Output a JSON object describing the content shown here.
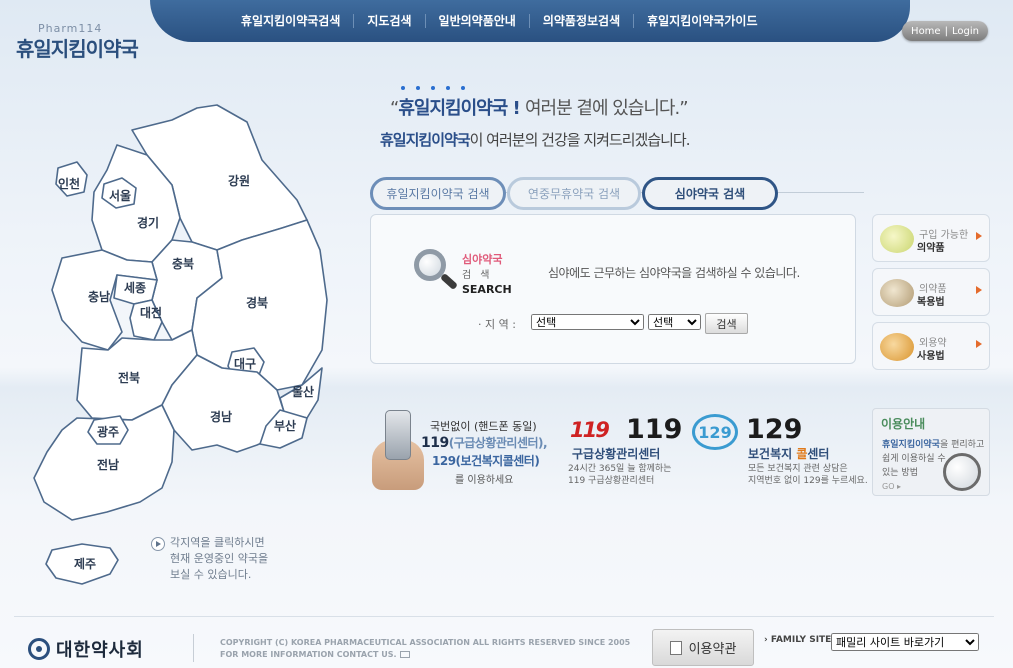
{
  "header": {
    "logo_small": "Pharm114",
    "logo_big": "휴일지킴이약국",
    "nav": [
      "휴일지킴이약국검색",
      "지도검색",
      "일반의약품안내",
      "의약품정보검색",
      "휴일지킴이약국가이드"
    ],
    "home": "Home",
    "login": "Login"
  },
  "slogan": {
    "line1_open": "“",
    "line1_hl": "휴일지킴이약국",
    "line1_bang": " ! ",
    "line1_rest": "여러분 곁에 있습니다.”",
    "line2_hl": "휴일지킴이약국",
    "line2_rest": "이 여러분의 건강을 지켜드리겠습니다."
  },
  "tabs": [
    "휴일지킴이약국 검색",
    "연중무휴약국 검색",
    "심야약국 검색"
  ],
  "search": {
    "icon_t1": "심야약국",
    "icon_t2": "검색",
    "icon_t3": "SEARCH",
    "description": "심야에도 근무하는 심야약국을 검색하실 수 있습니다.",
    "region_label": "· 지 역 :",
    "select1": "선택",
    "select2": "선택",
    "button": "검색"
  },
  "side_cards": [
    {
      "t1": "구입 가능한",
      "t2": "의약품"
    },
    {
      "t1": "의약품",
      "t2": "복용법"
    },
    {
      "t1": "외용약",
      "t2": "사용법"
    }
  ],
  "info_emergency": {
    "t1": "국번없이 (핸드폰 동일)",
    "t2_num": "119",
    "t2_rest": "(구급상황관리센터),",
    "t3": "129(보건복지콜센터)",
    "t4": "를 이용하세요"
  },
  "info_119": {
    "logo": "119",
    "num": "119",
    "name": "구급상황관리센터",
    "d1": "24시간 365일 늘 함께하는",
    "d2": "119 구급상황관리센터"
  },
  "info_129": {
    "logo": "129",
    "num": "129",
    "name_a": "보건복지 ",
    "name_b": "콜",
    "name_c": "센터",
    "d1": "모든 보건복지 관련 상담은",
    "d2": "지역번호 없이 129를 누르세요."
  },
  "guide": {
    "title": "이용안내",
    "l1_hl": "휴일지킴이약국",
    "l1_rest": "을 편리하고",
    "l2": "쉽게 이용하실 수",
    "l3": "있는 방법",
    "go": "GO ▸"
  },
  "map": {
    "regions": [
      "인천",
      "서울",
      "경기",
      "강원",
      "충북",
      "세종",
      "충남",
      "대전",
      "경북",
      "대구",
      "전북",
      "울산",
      "경남",
      "광주",
      "부산",
      "전남",
      "제주"
    ],
    "note": [
      "각지역을 클릭하시면",
      "현재 운영중인 약국을",
      "보실 수 있습니다."
    ]
  },
  "footer": {
    "org_name": "대한약사회",
    "copy1": "COPYRIGHT (C) KOREA PHARMACEUTICAL ASSOCIATION ALL RIGHTS RESERVED SINCE 2005",
    "copy2": "FOR MORE INFORMATION CONTACT US.",
    "terms": "이용약관",
    "family_label": "FAMILY SITE",
    "family_select": "패밀리 사이트 바로가기"
  }
}
